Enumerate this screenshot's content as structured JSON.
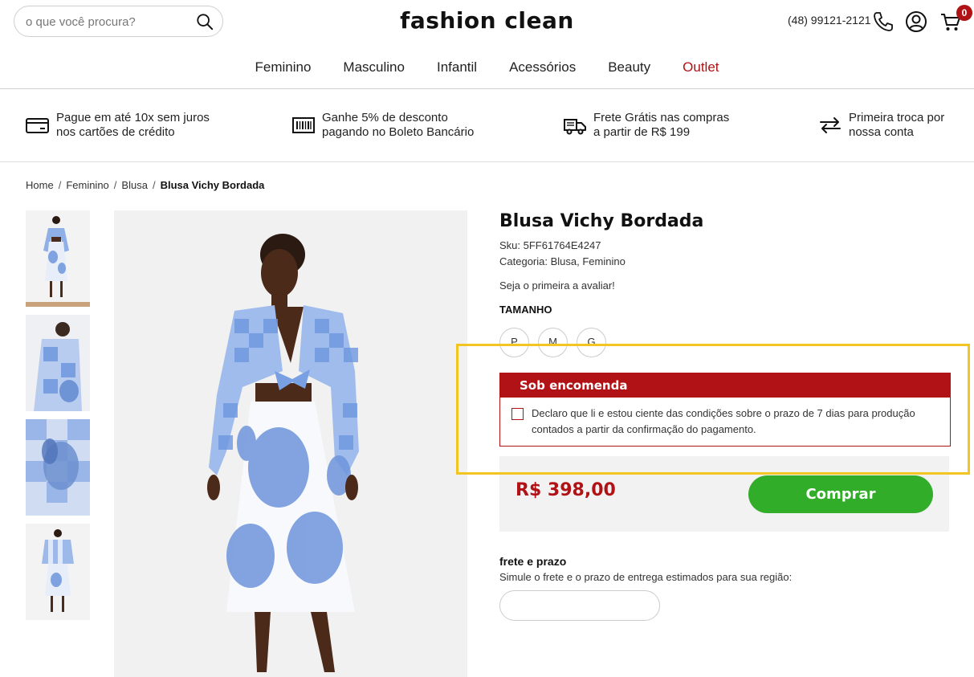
{
  "header": {
    "search_placeholder": "o que você procura?",
    "logo": "fashion clean",
    "phone": "(48) 99121-2121",
    "cart_count": "0",
    "icons": [
      "search-icon",
      "phone-icon",
      "user-icon",
      "cart-icon"
    ]
  },
  "nav": {
    "items": [
      "Feminino",
      "Masculino",
      "Infantil",
      "Acessórios",
      "Beauty",
      "Outlet"
    ],
    "accent_color": "#b01215"
  },
  "benefits": [
    {
      "icon": "credit-card-icon",
      "line1": "Pague em até 10x sem juros",
      "line2": "nos cartões de crédito"
    },
    {
      "icon": "barcode-icon",
      "line1": "Ganhe 5% de desconto",
      "line2": "pagando no Boleto Bancário"
    },
    {
      "icon": "truck-icon",
      "line1": "Frete Grátis nas compras",
      "line2": "a partir de R$ 199"
    },
    {
      "icon": "exchange-icon",
      "line1": "Primeira troca por",
      "line2": "nossa conta"
    }
  ],
  "breadcrumb": [
    "Home",
    "Feminino",
    "Blusa",
    "Blusa Vichy Bordada"
  ],
  "product": {
    "title": "Blusa Vichy Bordada",
    "sku": "Sku: 5FF61764E4247",
    "category": "Categoria: Blusa,  Feminino",
    "rating": "Seja o primeira a avaliar!",
    "size_label": "TAMANHO",
    "sizes": [
      "P",
      "M",
      "G"
    ],
    "order_notice_title": "Sob encomenda",
    "order_notice_text": "Declaro que li e estou ciente das condições sobre o prazo de 7 dias para produção contados a partir da confirmação do pagamento.",
    "price": "R$ 398,00",
    "buy_label": "Comprar"
  },
  "shipping": {
    "title": "frete e prazo",
    "subtitle": "Simule o frete e o prazo de entrega estimados para sua região:",
    "cep_value": ""
  },
  "colors": {
    "brand_red": "#b01215",
    "buy_green": "#31ad2a",
    "highlight": "#f3c521"
  }
}
